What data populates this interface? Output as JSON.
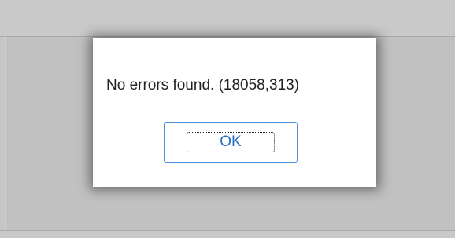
{
  "dialog": {
    "message": "No errors found. (18058,313)",
    "ok_label": "OK"
  },
  "colors": {
    "backdrop": "#c6c6c6",
    "dialog_background": "#ffffff",
    "button_border": "#4a8fd8",
    "button_text": "#2a6fbf"
  }
}
